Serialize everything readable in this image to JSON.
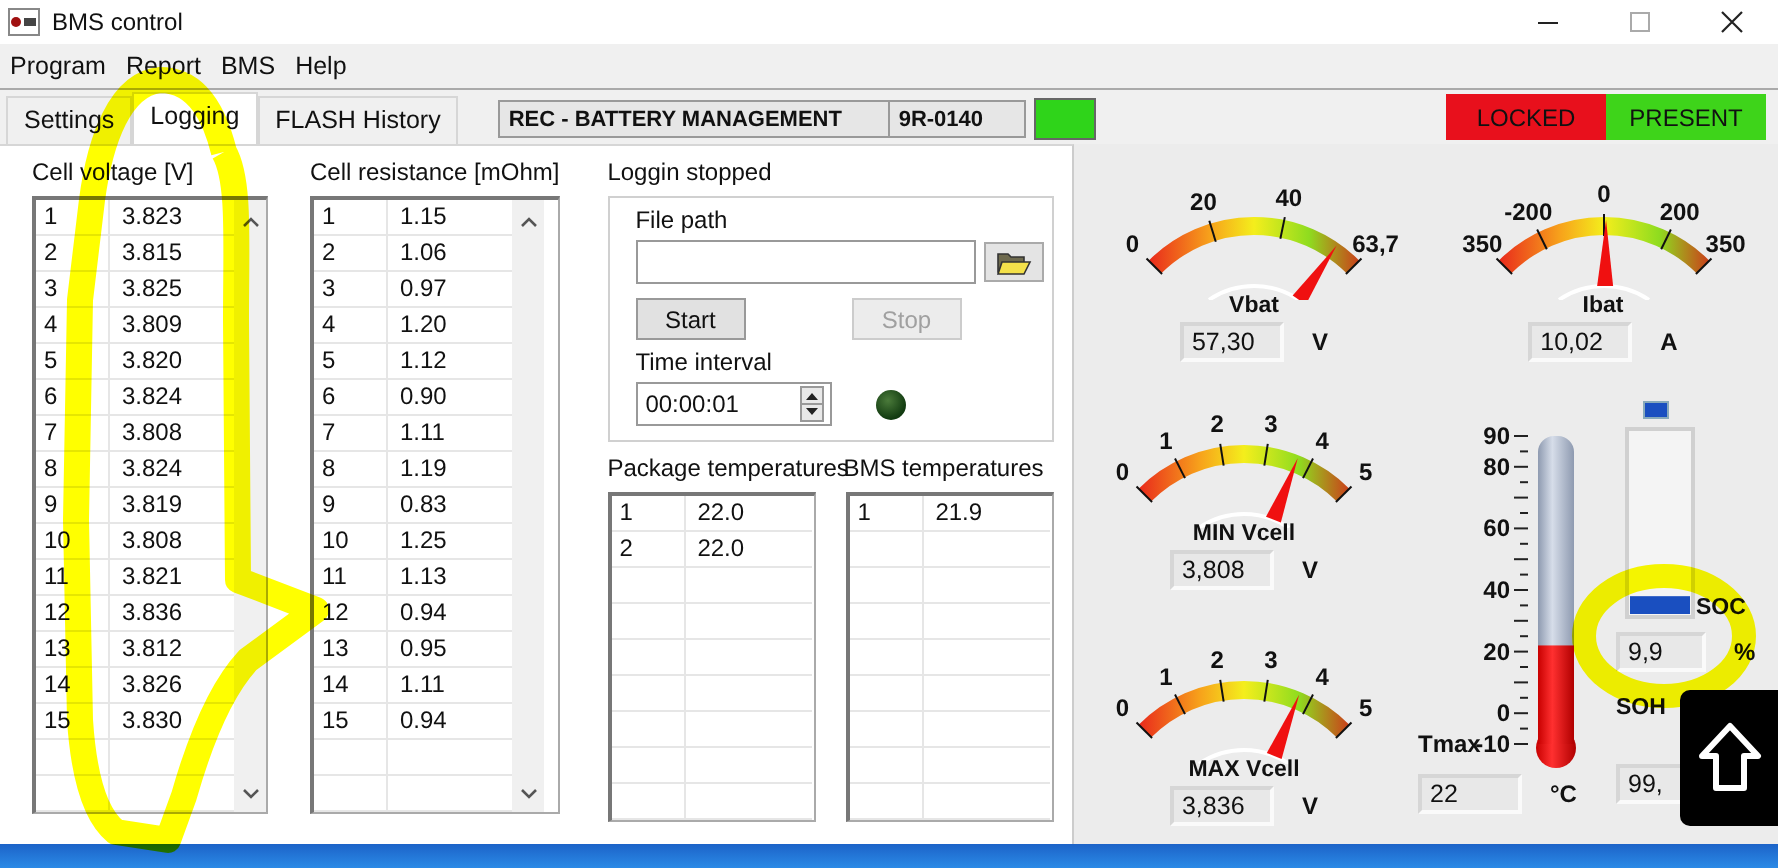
{
  "window": {
    "title": "BMS control"
  },
  "menu": [
    "Program",
    "Report",
    "BMS",
    "Help"
  ],
  "tabs": [
    {
      "label": "Settings",
      "selected": false
    },
    {
      "label": "Logging",
      "selected": true
    },
    {
      "label": "FLASH History",
      "selected": false
    }
  ],
  "header": {
    "device": "REC - BATTERY MANAGEMENT",
    "serial": "9R-0140",
    "connected": true
  },
  "status": [
    {
      "label": "LOCKED",
      "color": "#e8101c"
    },
    {
      "label": "PRESENT",
      "color": "#3ed41a"
    }
  ],
  "cell_voltage": {
    "title": "Cell voltage [V]",
    "rows": [
      [
        "1",
        "3.823"
      ],
      [
        "2",
        "3.815"
      ],
      [
        "3",
        "3.825"
      ],
      [
        "4",
        "3.809"
      ],
      [
        "5",
        "3.820"
      ],
      [
        "6",
        "3.824"
      ],
      [
        "7",
        "3.808"
      ],
      [
        "8",
        "3.824"
      ],
      [
        "9",
        "3.819"
      ],
      [
        "10",
        "3.808"
      ],
      [
        "11",
        "3.821"
      ],
      [
        "12",
        "3.836"
      ],
      [
        "13",
        "3.812"
      ],
      [
        "14",
        "3.826"
      ],
      [
        "15",
        "3.830"
      ]
    ]
  },
  "cell_resistance": {
    "title": "Cell resistance [mOhm]",
    "rows": [
      [
        "1",
        "1.15"
      ],
      [
        "2",
        "1.06"
      ],
      [
        "3",
        "0.97"
      ],
      [
        "4",
        "1.20"
      ],
      [
        "5",
        "1.12"
      ],
      [
        "6",
        "0.90"
      ],
      [
        "7",
        "1.11"
      ],
      [
        "8",
        "1.19"
      ],
      [
        "9",
        "0.83"
      ],
      [
        "10",
        "1.25"
      ],
      [
        "11",
        "1.13"
      ],
      [
        "12",
        "0.94"
      ],
      [
        "13",
        "0.95"
      ],
      [
        "14",
        "1.11"
      ],
      [
        "15",
        "0.94"
      ]
    ]
  },
  "logging": {
    "status": "Loggin stopped",
    "file_path_label": "File path",
    "start": {
      "label": "Start",
      "disabled": false
    },
    "stop": {
      "label": "Stop",
      "disabled": true
    },
    "interval_label": "Time interval",
    "interval": "00:00:01",
    "recording": false
  },
  "package_temperatures": {
    "title": "Package temperatures",
    "rows": [
      [
        "1",
        "22.0"
      ],
      [
        "2",
        "22.0"
      ]
    ]
  },
  "bms_temperatures": {
    "title": "BMS temperatures",
    "rows": [
      [
        "1",
        "21.9"
      ]
    ]
  },
  "gauges": [
    {
      "kind": "voltage",
      "name": "Vbat",
      "ticks": [
        "0",
        "20",
        "40",
        "63,7"
      ],
      "level": 0.9,
      "value": "57,30",
      "unit": "V"
    },
    {
      "kind": "current",
      "name": "Ibat",
      "ticks": [
        "350",
        "-200",
        "0",
        "200",
        "350"
      ],
      "level": 0.51,
      "value": "10,02",
      "unit": "A"
    },
    {
      "kind": "cell",
      "name": "MIN Vcell",
      "ticks": [
        "0",
        "1",
        "2",
        "3",
        "4",
        "5"
      ],
      "level": 0.76,
      "value": "3,808",
      "unit": "V"
    },
    {
      "kind": "cell",
      "name": "MAX Vcell",
      "ticks": [
        "0",
        "1",
        "2",
        "3",
        "4",
        "5"
      ],
      "level": 0.767,
      "value": "3,836",
      "unit": "V"
    }
  ],
  "temperature": {
    "name": "Tmax",
    "ticks": [
      "90",
      "80",
      "60",
      "40",
      "20",
      "0",
      "-10"
    ],
    "level": 0.32,
    "value": "22",
    "unit": "°C"
  },
  "soc": {
    "name": "SOC",
    "level": 0.099,
    "value": "9,9",
    "unit": "%"
  },
  "soh": {
    "name": "SOH",
    "value": "99,"
  }
}
